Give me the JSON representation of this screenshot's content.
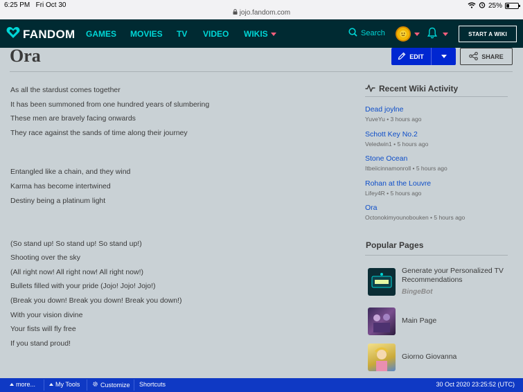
{
  "status_bar": {
    "time": "6:25 PM",
    "date": "Fri Oct 30",
    "battery": "25%",
    "battery_level": 0.25,
    "url": "jojo.fandom.com"
  },
  "nav": {
    "logo": "FANDOM",
    "links": [
      "GAMES",
      "MOVIES",
      "TV",
      "VIDEO",
      "WIKIS"
    ],
    "search_label": "Search",
    "start_wiki": "START A WIKI",
    "colors": {
      "bg": "#002a32",
      "link": "#00d6d6",
      "accent": "#ff5f7d"
    }
  },
  "page": {
    "title": "Ora",
    "edit_label": "EDIT",
    "share_label": "SHARE"
  },
  "lyrics": [
    "As all the stardust comes together",
    "It has been summoned from one hundred years of slumbering",
    "These men are bravely facing onwards",
    "They race against the sands of time along their journey",
    "Entangled like a chain, and they wind",
    "Karma has become intertwined",
    "Destiny being a platinum light",
    "(So stand up! So stand up! So stand up!)",
    "Shooting over the sky",
    "(All right now! All right now! All right now!)",
    "Bullets filled with your pride (Jojo! Jojo! Jojo!)",
    "(Break you down! Break you down! Break you down!)",
    "With your vision divine",
    "Your fists will fly free",
    "If you stand proud!"
  ],
  "recent_activity": {
    "heading": "Recent Wiki Activity",
    "items": [
      {
        "title": "Dead joylne",
        "meta": "YuveYu • 3 hours ago"
      },
      {
        "title": "Schott Key No.2",
        "meta": "Veledwin1 • 5 hours ago"
      },
      {
        "title": "Stone Ocean",
        "meta": "Itbeiicinnamonroll • 5 hours ago"
      },
      {
        "title": "Rohan at the Louvre",
        "meta": "Lifey4R • 5 hours ago"
      },
      {
        "title": "Ora",
        "meta": "Octonokimyounobouken • 5 hours ago"
      }
    ]
  },
  "popular_pages": {
    "heading": "Popular Pages",
    "items": [
      {
        "title": "Generate your Personalized TV Recommendations",
        "sub": "BingeBot"
      },
      {
        "title": "Main Page",
        "sub": ""
      },
      {
        "title": "Giorno Giovanna",
        "sub": ""
      }
    ]
  },
  "toolbar": {
    "more": "more...",
    "my_tools": "My Tools",
    "customize": "Customize",
    "shortcuts": "Shortcuts",
    "timestamp": "30 Oct 2020 23:25:52 (UTC)"
  }
}
